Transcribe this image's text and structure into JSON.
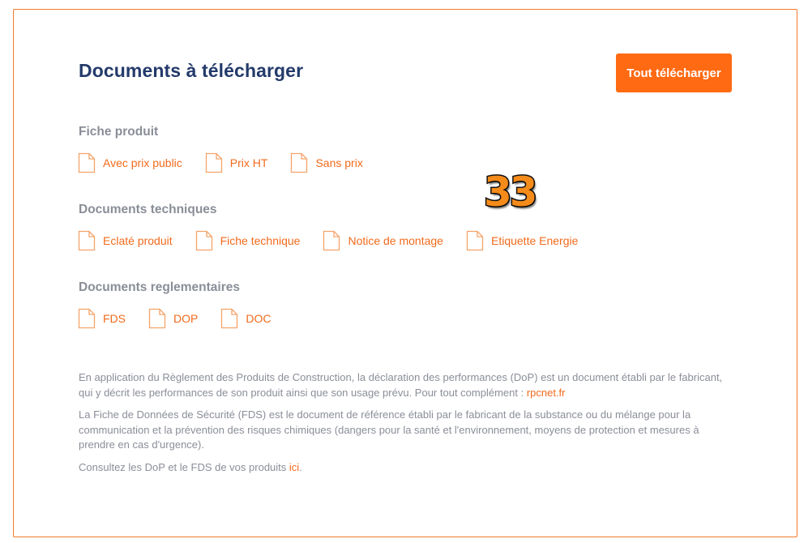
{
  "header": {
    "title": "Documents à télécharger",
    "download_all_label": "Tout télécharger"
  },
  "sections": [
    {
      "title": "Fiche produit",
      "items": [
        "Avec prix public",
        "Prix HT",
        "Sans prix"
      ]
    },
    {
      "title": "Documents techniques",
      "items": [
        "Eclaté produit",
        "Fiche technique",
        "Notice de montage",
        "Etiquette Energie"
      ]
    },
    {
      "title": "Documents reglementaires",
      "items": [
        "FDS",
        "DOP",
        "DOC"
      ]
    }
  ],
  "badge": "33",
  "info": {
    "p1_text": "En application du Règlement des Produits de Construction, la déclaration des performances (DoP) est un document établi par le fabricant, qui y décrit les performances de son produit ainsi que son usage prévu. Pour tout complément : ",
    "p1_link": "rpcnet.fr",
    "p2_text": "La Fiche de Données de Sécurité (FDS) est le document de référence établi par le fabricant de la substance ou du mélange pour la communication et la prévention des risques chimiques (dangers pour la santé et l'environnement, moyens de protection et mesures à prendre en cas d'urgence).",
    "p3_text": "Consultez les DoP et le FDS de vos produits ",
    "p3_link": "ici",
    "p3_end": "."
  },
  "colors": {
    "accent": "#ff6a13",
    "title": "#233a6b",
    "muted": "#8a8e98",
    "border": "#f07a2a"
  },
  "icons": {
    "document": "document-icon"
  }
}
